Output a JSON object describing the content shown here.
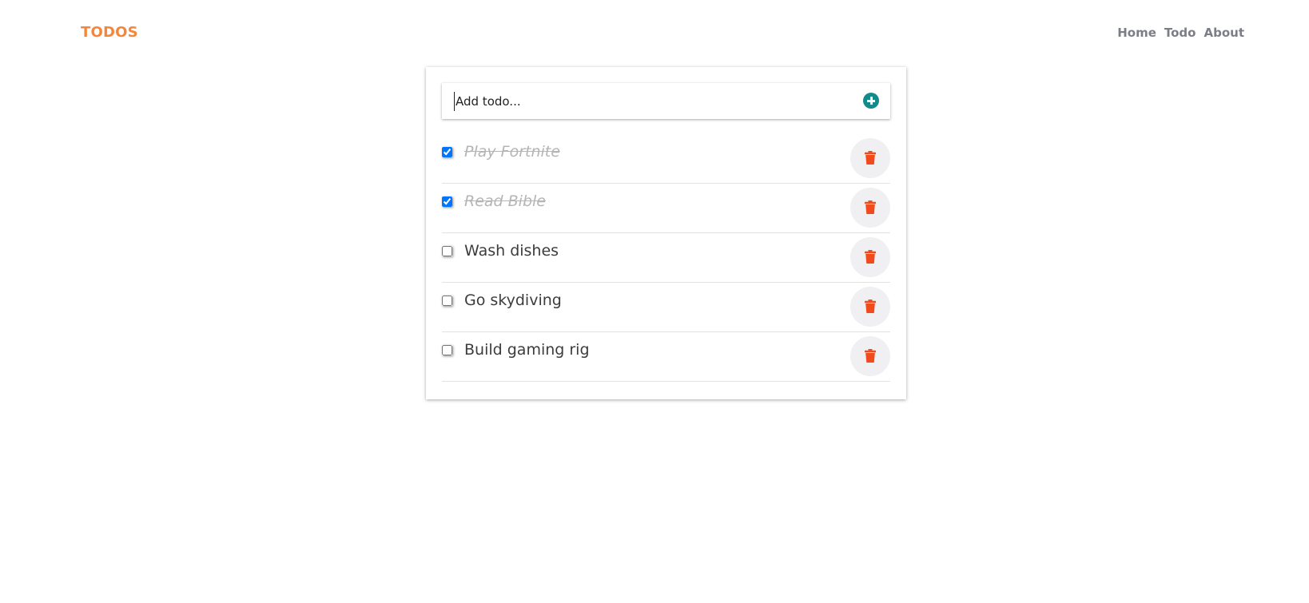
{
  "header": {
    "brand": "TODOS",
    "nav": [
      {
        "label": "Home"
      },
      {
        "label": "Todo"
      },
      {
        "label": "About"
      }
    ]
  },
  "add_form": {
    "placeholder": "Add todo..."
  },
  "todos": [
    {
      "text": "Play Fortnite",
      "completed": true
    },
    {
      "text": "Read Bible",
      "completed": true
    },
    {
      "text": "Wash dishes",
      "completed": false
    },
    {
      "text": "Go skydiving",
      "completed": false
    },
    {
      "text": "Build gaming rig",
      "completed": false
    }
  ],
  "colors": {
    "brand": "#f5873a",
    "nav_text": "#7b7e87",
    "add_button": "#138b8a",
    "delete_icon": "#f14a1c",
    "delete_button_bg": "#f0f0f2",
    "completed_text": "#b5b5b5"
  },
  "icons": {
    "add": "plus-circle-icon",
    "delete": "trash-icon"
  }
}
